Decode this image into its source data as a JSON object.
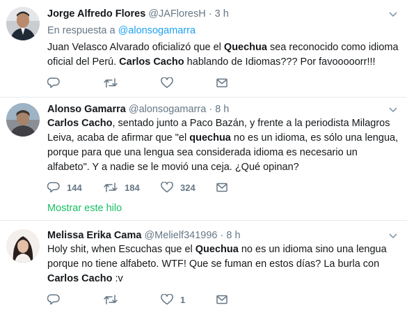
{
  "tweets": [
    {
      "name": "Jorge Alfredo Flores",
      "handle": "@JAFloresH",
      "dot": "·",
      "time": "3 h",
      "reply_prefix": "En respuesta a",
      "reply_to": "@alonsogamarra",
      "text_parts": [
        "Juan Velasco Alvarado oficializó que el ",
        "Quechua",
        " sea reconocido como idioma oficial del Perú. ",
        "Carlos Cacho",
        " hablando de Idiomas??? Por favooooorr!!!"
      ],
      "counts": {
        "reply": "",
        "retweet": "",
        "like": ""
      }
    },
    {
      "name": "Alonso Gamarra",
      "handle": "@alonsogamarra",
      "dot": "·",
      "time": "8 h",
      "text_parts": [
        "Carlos Cacho",
        ", sentado junto a Paco Bazán, y frente a la periodista Milagros Leiva, acaba de afirmar que \"el ",
        "quechua",
        " no es un idioma, es sólo una lengua, porque para que una lengua sea considerada idioma es necesario un alfabeto\". Y a nadie se le movió una ceja. ¿Qué opinan?"
      ],
      "counts": {
        "reply": "144",
        "retweet": "184",
        "like": "324"
      },
      "show_thread": "Mostrar este hilo"
    },
    {
      "name": "Melissa Erika Cama",
      "handle": "@Melielf341996",
      "dot": "·",
      "time": "8 h",
      "text_parts": [
        "Holy shit, when Escuchas que el ",
        "Quechua",
        " no es un idioma sino una lengua porque no tiene alfabeto. WTF! Que se fuman en estos días? La burla con ",
        "Carlos Cacho",
        " :v"
      ],
      "counts": {
        "reply": "",
        "retweet": "",
        "like": "1"
      }
    }
  ],
  "icons": {
    "reply": "reply-icon",
    "retweet": "retweet-icon",
    "like": "heart-icon",
    "dm": "envelope-icon",
    "more": "chevron-down-icon"
  },
  "colors": {
    "link": "#1da1f2",
    "thread": "#17bf63",
    "secondary": "#657786",
    "border": "#e6ecf0"
  }
}
